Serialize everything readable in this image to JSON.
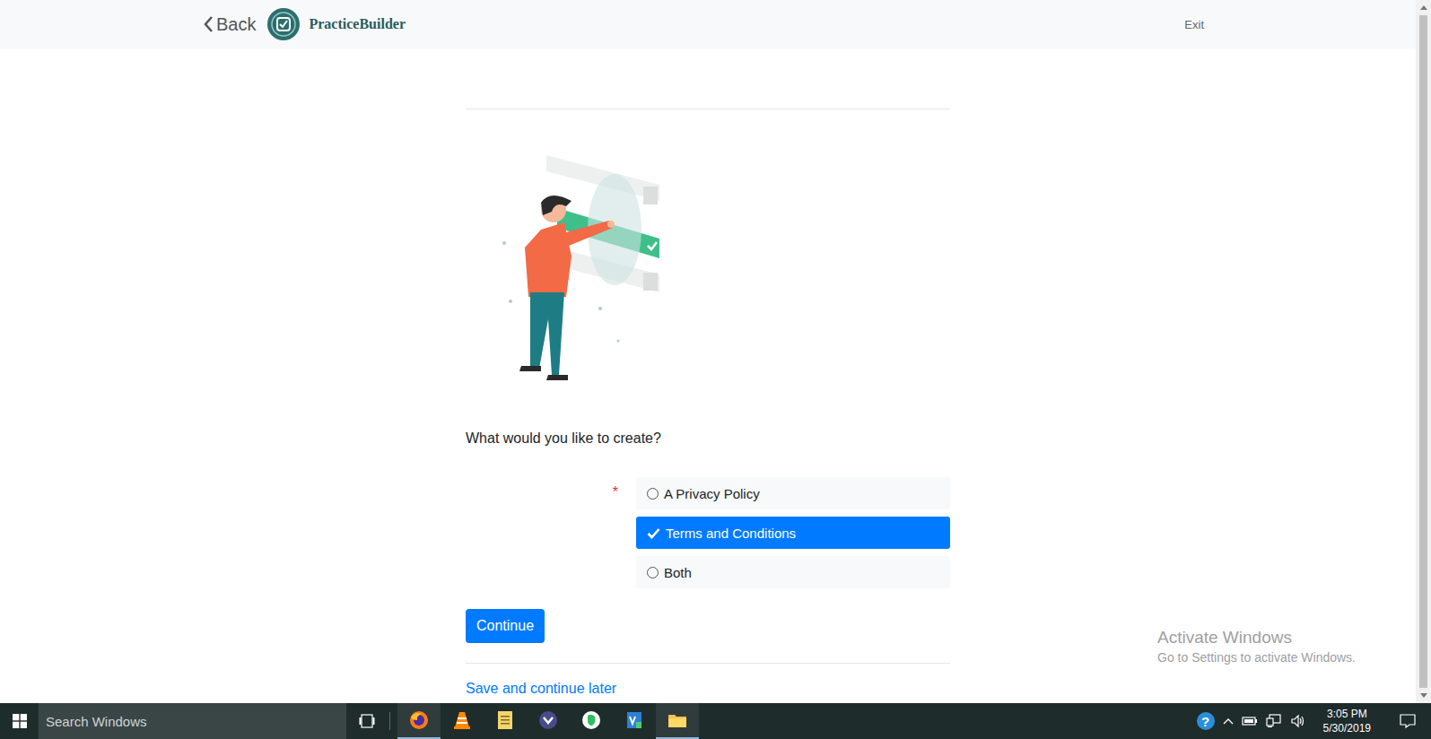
{
  "header": {
    "back": "Back",
    "brand": "PracticeBuilder",
    "exit": "Exit"
  },
  "form": {
    "question": "What would you like to create?",
    "required": "*",
    "options": [
      {
        "label": "A Privacy Policy",
        "selected": false
      },
      {
        "label": "Terms and Conditions",
        "selected": true
      },
      {
        "label": "Both",
        "selected": false
      }
    ],
    "continue": "Continue",
    "save_later": "Save and continue later"
  },
  "watermark": {
    "title": "Activate Windows",
    "subtitle": "Go to Settings to activate Windows."
  },
  "taskbar": {
    "search": {
      "placeholder": "Search Windows"
    },
    "apps": [
      {
        "kind": "firefox",
        "running": true
      },
      {
        "kind": "vlc",
        "running": false
      },
      {
        "kind": "notes",
        "running": false
      },
      {
        "kind": "purple",
        "running": false
      },
      {
        "kind": "evernote",
        "running": false
      },
      {
        "kind": "vz",
        "running": false
      },
      {
        "kind": "folder",
        "running": true
      }
    ],
    "tray": {
      "help": "?",
      "time": "3:05 PM",
      "date": "5/30/2019"
    }
  }
}
